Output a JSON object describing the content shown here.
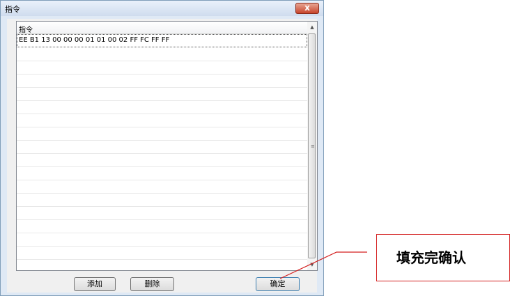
{
  "window": {
    "title": "指令",
    "close_label": "x"
  },
  "list": {
    "column_header": "指令",
    "rows": [
      "EE B1 13 00 00 00 01 01 00 02 FF FC FF FF"
    ],
    "selected_row": 0
  },
  "scrollbar": {
    "up_arrow": "▲",
    "down_arrow": "▼",
    "grip": "≡"
  },
  "buttons": {
    "add_label": "添加",
    "delete_label": "删除",
    "ok_label": "确定"
  },
  "annotation": {
    "text": "填充完确认",
    "color": "#d41f1f"
  }
}
